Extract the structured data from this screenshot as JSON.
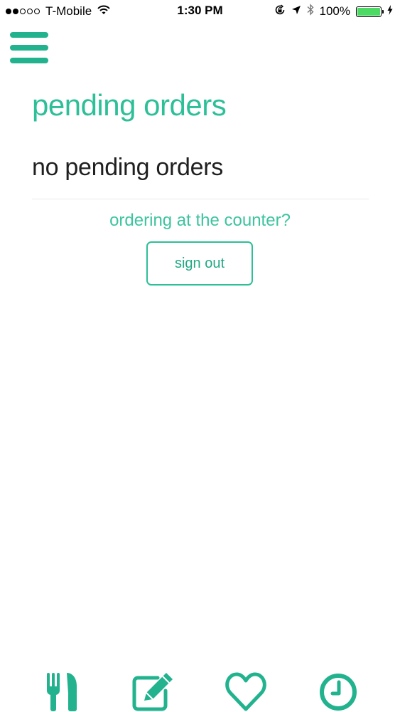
{
  "status_bar": {
    "carrier": "T-Mobile",
    "time": "1:30 PM",
    "battery_percent": "100%",
    "battery_level": 1.0,
    "signal_bars_filled": 2,
    "signal_bars_total": 5,
    "icons": [
      "wifi-icon",
      "orientation-lock-icon",
      "location-arrow-icon",
      "bluetooth-icon",
      "battery-icon",
      "charging-bolt-icon"
    ]
  },
  "header": {
    "menu_icon": "hamburger-menu-icon"
  },
  "main": {
    "title": "pending orders",
    "empty_message": "no pending orders",
    "counter_question": "ordering at the counter?",
    "sign_out_label": "sign out"
  },
  "tab_bar": {
    "tabs": [
      {
        "icon": "fork-knife-icon"
      },
      {
        "icon": "edit-note-icon"
      },
      {
        "icon": "heart-icon"
      },
      {
        "icon": "clock-icon"
      }
    ]
  },
  "colors": {
    "accent": "#2dbf97",
    "accent_dark": "#22b38e",
    "text": "#1f1f1f",
    "battery": "#4cd964"
  }
}
